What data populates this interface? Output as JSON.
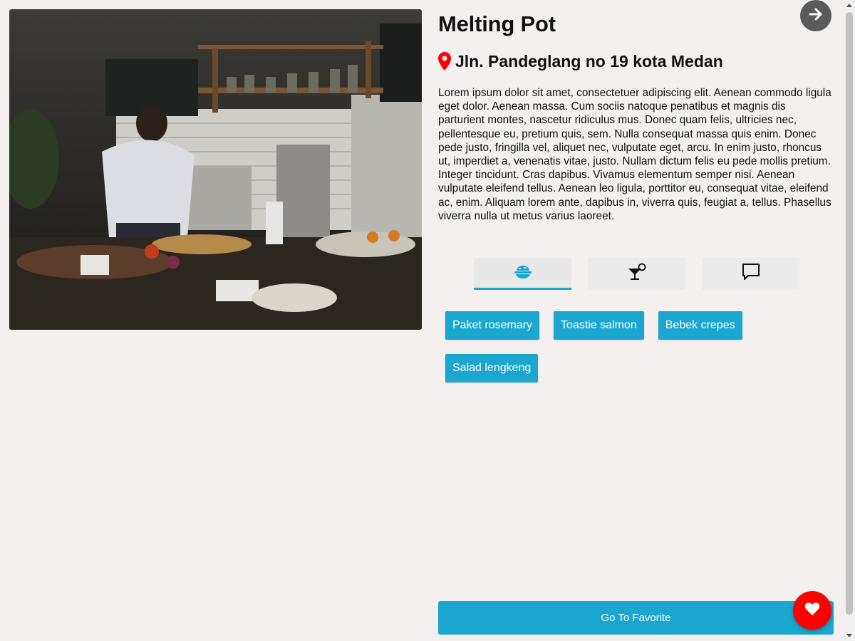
{
  "restaurant": {
    "name": "Melting Pot",
    "address": "Jln. Pandeglang no 19 kota Medan",
    "description": "Lorem ipsum dolor sit amet, consectetuer adipiscing elit. Aenean commodo ligula eget dolor. Aenean massa. Cum sociis natoque penatibus et magnis dis parturient montes, nascetur ridiculus mus. Donec quam felis, ultricies nec, pellentesque eu, pretium quis, sem. Nulla consequat massa quis enim. Donec pede justo, fringilla vel, aliquet nec, vulputate eget, arcu. In enim justo, rhoncus ut, imperdiet a, venenatis vitae, justo. Nullam dictum felis eu pede mollis pretium. Integer tincidunt. Cras dapibus. Vivamus elementum semper nisi. Aenean vulputate eleifend tellus. Aenean leo ligula, porttitor eu, consequat vitae, eleifend ac, enim. Aliquam lorem ante, dapibus in, viverra quis, feugiat a, tellus. Phasellus viverra nulla ut metus varius laoreet."
  },
  "tabs": [
    {
      "icon": "food-bowl-icon",
      "active": true
    },
    {
      "icon": "cocktail-icon",
      "active": false
    },
    {
      "icon": "comment-icon",
      "active": false
    }
  ],
  "menu_items": [
    "Paket rosemary",
    "Toastie salmon",
    "Bebek crepes",
    "Salad lengkeng"
  ],
  "buttons": {
    "go_to_favorite": "Go To Favorite"
  },
  "colors": {
    "accent": "#1aa6cf",
    "favorite": "#ff0000",
    "pin": "#ff0000",
    "next_button": "#5a5a5a",
    "background": "#f4f0ef"
  },
  "icons": {
    "address": "location-pin-icon",
    "favorite": "heart-icon",
    "next": "arrow-right-icon"
  }
}
